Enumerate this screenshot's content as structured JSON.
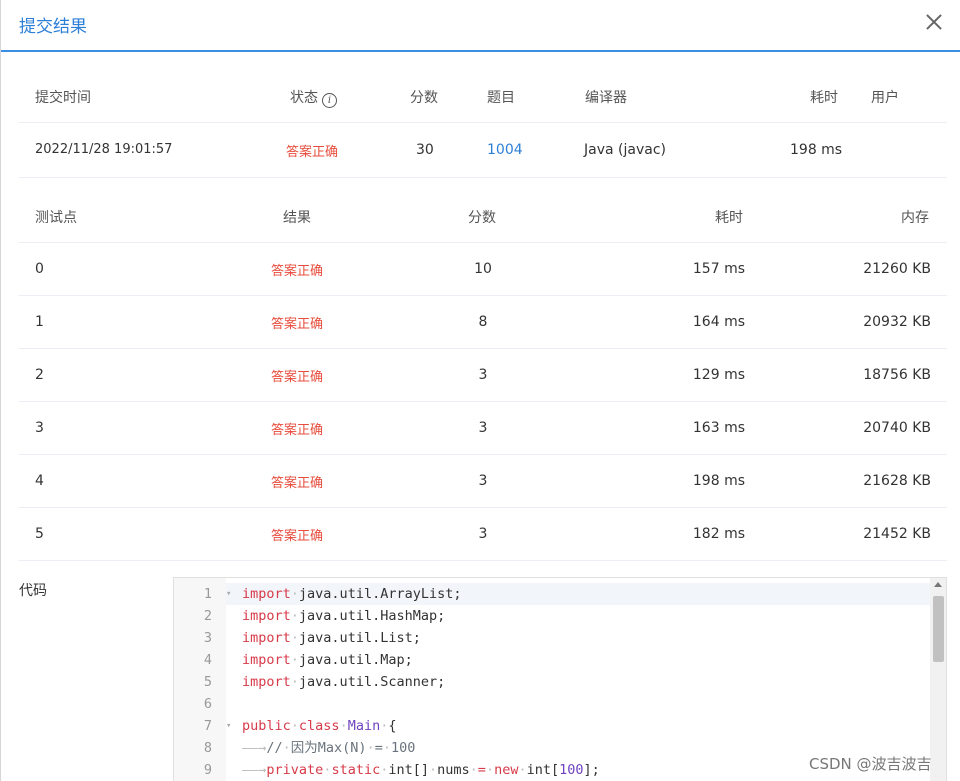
{
  "dialog": {
    "title": "提交结果"
  },
  "submission": {
    "headers": {
      "time": "提交时间",
      "status": "状态",
      "score": "分数",
      "problem": "题目",
      "compiler": "编译器",
      "time_cost": "耗时",
      "user": "用户"
    },
    "info_icon": "i",
    "row": {
      "time": "2022/11/28 19:01:57",
      "status": "答案正确",
      "score": "30",
      "problem": "1004",
      "compiler": "Java (javac)",
      "time_cost": "198 ms",
      "user": ""
    }
  },
  "testcases": {
    "headers": {
      "case": "测试点",
      "result": "结果",
      "score": "分数",
      "time": "耗时",
      "memory": "内存"
    },
    "rows": [
      {
        "case": "0",
        "result": "答案正确",
        "score": "10",
        "time": "157 ms",
        "memory": "21260 KB"
      },
      {
        "case": "1",
        "result": "答案正确",
        "score": "8",
        "time": "164 ms",
        "memory": "20932 KB"
      },
      {
        "case": "2",
        "result": "答案正确",
        "score": "3",
        "time": "129 ms",
        "memory": "18756 KB"
      },
      {
        "case": "3",
        "result": "答案正确",
        "score": "3",
        "time": "163 ms",
        "memory": "20740 KB"
      },
      {
        "case": "4",
        "result": "答案正确",
        "score": "3",
        "time": "198 ms",
        "memory": "21628 KB"
      },
      {
        "case": "5",
        "result": "答案正确",
        "score": "3",
        "time": "182 ms",
        "memory": "21452 KB"
      }
    ]
  },
  "code": {
    "label": "代码",
    "lines": [
      {
        "n": "1",
        "tokens": [
          [
            "kw",
            "import"
          ],
          [
            "dot",
            "·"
          ],
          [
            "t",
            "java.util.ArrayList;"
          ]
        ]
      },
      {
        "n": "2",
        "tokens": [
          [
            "kw",
            "import"
          ],
          [
            "dot",
            "·"
          ],
          [
            "t",
            "java.util.HashMap;"
          ]
        ]
      },
      {
        "n": "3",
        "tokens": [
          [
            "kw",
            "import"
          ],
          [
            "dot",
            "·"
          ],
          [
            "t",
            "java.util.List;"
          ]
        ]
      },
      {
        "n": "4",
        "tokens": [
          [
            "kw",
            "import"
          ],
          [
            "dot",
            "·"
          ],
          [
            "t",
            "java.util.Map;"
          ]
        ]
      },
      {
        "n": "5",
        "tokens": [
          [
            "kw",
            "import"
          ],
          [
            "dot",
            "·"
          ],
          [
            "t",
            "java.util.Scanner;"
          ]
        ]
      },
      {
        "n": "6",
        "tokens": []
      },
      {
        "n": "7",
        "tokens": [
          [
            "kw",
            "public"
          ],
          [
            "dot",
            "·"
          ],
          [
            "kw",
            "class"
          ],
          [
            "dot",
            "·"
          ],
          [
            "cls",
            "Main"
          ],
          [
            "dot",
            "·"
          ],
          [
            "t",
            "{"
          ]
        ]
      },
      {
        "n": "8",
        "tokens": [
          [
            "dot",
            "——→"
          ],
          [
            "cm",
            "//"
          ],
          [
            "dot",
            "·"
          ],
          [
            "cm",
            "因为Max(N)"
          ],
          [
            "dot",
            "·"
          ],
          [
            "cm",
            "="
          ],
          [
            "dot",
            "·"
          ],
          [
            "cm",
            "100"
          ]
        ]
      },
      {
        "n": "9",
        "tokens": [
          [
            "dot",
            "——→"
          ],
          [
            "kw",
            "private"
          ],
          [
            "dot",
            "·"
          ],
          [
            "kw",
            "static"
          ],
          [
            "dot",
            "·"
          ],
          [
            "t",
            "int[]"
          ],
          [
            "dot",
            "·"
          ],
          [
            "t",
            "nums"
          ],
          [
            "dot",
            "·"
          ],
          [
            "kw",
            "="
          ],
          [
            "dot",
            "·"
          ],
          [
            "kw",
            "new"
          ],
          [
            "dot",
            "·"
          ],
          [
            "t",
            "int["
          ],
          [
            "cls",
            "100"
          ],
          [
            "t",
            "];"
          ]
        ]
      }
    ],
    "folds": [
      "1",
      "7"
    ]
  },
  "watermark": "CSDN @波吉波吉"
}
